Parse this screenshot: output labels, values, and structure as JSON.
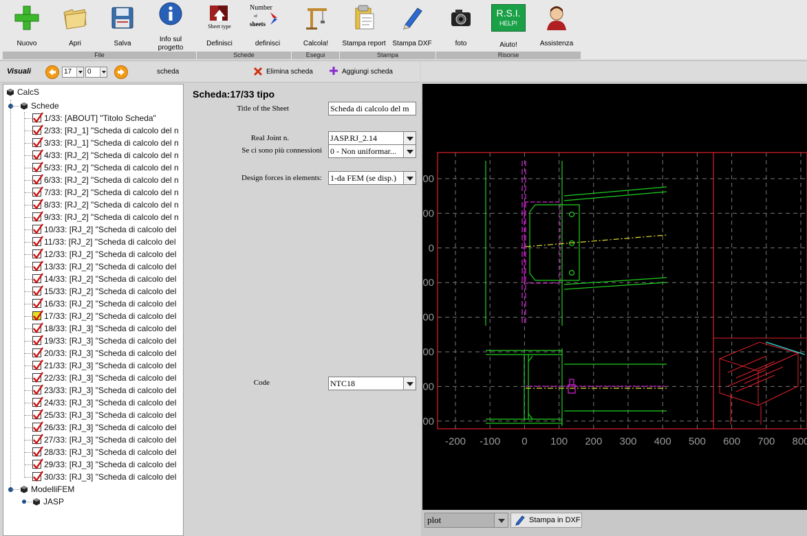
{
  "ribbon": {
    "buttons": [
      {
        "id": "nuovo",
        "label": "Nuovo",
        "icon": "plus-icon"
      },
      {
        "id": "apri",
        "label": "Apri",
        "icon": "folder-icon"
      },
      {
        "id": "salva",
        "label": "Salva",
        "icon": "floppy-icon"
      },
      {
        "id": "info",
        "label": "Info sul progetto",
        "icon": "info-icon"
      },
      {
        "id": "definisci1",
        "label": "Definisci",
        "icon": "sheet-type-icon",
        "icon_text": "Sheet type"
      },
      {
        "id": "definisci2",
        "label": "definisci",
        "icon": "number-of-sheets-icon",
        "icon_text": [
          "Number",
          "of",
          "sheets"
        ]
      },
      {
        "id": "calcola",
        "label": "Calcola!",
        "icon": "crane-icon"
      },
      {
        "id": "stampa_report",
        "label": "Stampa report",
        "icon": "report-icon"
      },
      {
        "id": "stampa_dxf",
        "label": "Stampa DXF",
        "icon": "pencil-icon"
      },
      {
        "id": "foto",
        "label": "foto",
        "icon": "camera-icon"
      },
      {
        "id": "aiuto",
        "label": "Aiuto!",
        "icon": "help-icon",
        "icon_text": [
          "R.S.I.",
          "HELP!"
        ]
      },
      {
        "id": "assistenza",
        "label": "Assistenza",
        "icon": "support-person-icon"
      }
    ],
    "groups": [
      "File",
      "Schede",
      "Esegui",
      "Stampa",
      "Risorse"
    ]
  },
  "toolbar": {
    "visuali_label": "Visuali",
    "sheet_num": "17",
    "sheet_sub": "0",
    "scheda_label": "scheda",
    "elimina_label": "Elimina scheda",
    "aggiungi_label": "Aggiungi scheda"
  },
  "tree": {
    "root": "CalcS",
    "schede": "Schede",
    "items": [
      {
        "label": "1/33: [ABOUT] \"Titolo Scheda\"",
        "state": "red"
      },
      {
        "label": "2/33: [RJ_1] \"Scheda di calcolo del n",
        "state": "red"
      },
      {
        "label": "3/33: [RJ_1] \"Scheda di calcolo del n",
        "state": "red"
      },
      {
        "label": "4/33: [RJ_2] \"Scheda di calcolo del n",
        "state": "red"
      },
      {
        "label": "5/33: [RJ_2] \"Scheda di calcolo del n",
        "state": "red"
      },
      {
        "label": "6/33: [RJ_2] \"Scheda di calcolo del n",
        "state": "red"
      },
      {
        "label": "7/33: [RJ_2] \"Scheda di calcolo del n",
        "state": "red"
      },
      {
        "label": "8/33: [RJ_2] \"Scheda di calcolo del n",
        "state": "red"
      },
      {
        "label": "9/33: [RJ_2] \"Scheda di calcolo del n",
        "state": "red"
      },
      {
        "label": "10/33: [RJ_2] \"Scheda di calcolo del",
        "state": "red"
      },
      {
        "label": "11/33: [RJ_2] \"Scheda di calcolo del",
        "state": "red"
      },
      {
        "label": "12/33: [RJ_2] \"Scheda di calcolo del",
        "state": "red"
      },
      {
        "label": "13/33: [RJ_2] \"Scheda di calcolo del",
        "state": "red"
      },
      {
        "label": "14/33: [RJ_2] \"Scheda di calcolo del",
        "state": "red"
      },
      {
        "label": "15/33: [RJ_2] \"Scheda di calcolo del",
        "state": "red"
      },
      {
        "label": "16/33: [RJ_2] \"Scheda di calcolo del",
        "state": "red"
      },
      {
        "label": "17/33: [RJ_2] \"Scheda di calcolo del",
        "state": "yellow"
      },
      {
        "label": "18/33: [RJ_3] \"Scheda di calcolo del",
        "state": "red"
      },
      {
        "label": "19/33: [RJ_3] \"Scheda di calcolo del",
        "state": "red"
      },
      {
        "label": "20/33: [RJ_3] \"Scheda di calcolo del",
        "state": "red"
      },
      {
        "label": "21/33: [RJ_3] \"Scheda di calcolo del",
        "state": "red"
      },
      {
        "label": "22/33: [RJ_3] \"Scheda di calcolo del",
        "state": "red"
      },
      {
        "label": "23/33: [RJ_3] \"Scheda di calcolo del",
        "state": "red"
      },
      {
        "label": "24/33: [RJ_3] \"Scheda di calcolo del",
        "state": "red"
      },
      {
        "label": "25/33: [RJ_3] \"Scheda di calcolo del",
        "state": "red"
      },
      {
        "label": "26/33: [RJ_3] \"Scheda di calcolo del",
        "state": "red"
      },
      {
        "label": "27/33: [RJ_3] \"Scheda di calcolo del",
        "state": "red"
      },
      {
        "label": "28/33: [RJ_3] \"Scheda di calcolo del",
        "state": "red"
      },
      {
        "label": "29/33: [RJ_3] \"Scheda di calcolo del",
        "state": "red"
      },
      {
        "label": "30/33: [RJ_3] \"Scheda di calcolo del",
        "state": "red"
      }
    ],
    "modelli": "ModelliFEM",
    "jasp": "JASP"
  },
  "form": {
    "title": "Scheda:17/33 tipo",
    "title_label": "Title of the Sheet",
    "title_value": "Scheda di calcolo del m",
    "joint_label": "Real Joint n.",
    "joint_value": "JASP.RJ_2.14",
    "conn_label": "Se ci sono più connessioni",
    "conn_value": "0 - Non uniformar...",
    "forces_label": "Design forces in elements:",
    "forces_value": "1-da FEM (se disp.)",
    "code_label": "Code",
    "code_value": "NTC18"
  },
  "viewport": {
    "x_ticks": [
      "-200",
      "-100",
      "0",
      "100",
      "200",
      "300",
      "400",
      "500",
      "600",
      "700",
      "800"
    ],
    "y_ticks": [
      "00",
      "00",
      "0",
      "00",
      "00",
      "00",
      "00",
      "00"
    ],
    "plot_select": "plot",
    "dxf_button": "Stampa in DXF"
  },
  "colors": {
    "accent_orange": "#f29a14",
    "check_red": "#d01010",
    "grid": "#7a7a7a",
    "frame_red": "#e0202a",
    "steel_green": "#20d020",
    "magenta": "#e020e0",
    "axis_yellow": "#e8e030"
  }
}
